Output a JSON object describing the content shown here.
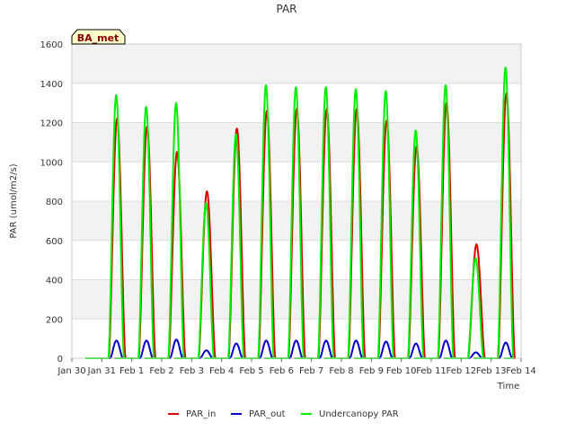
{
  "chart_data": {
    "type": "line",
    "title": "PAR",
    "xlabel": "Time",
    "ylabel": "PAR (umol/m2/s)",
    "badge": "BA_met",
    "ylim": [
      0,
      1600
    ],
    "yticks": [
      0,
      200,
      400,
      600,
      800,
      1000,
      1200,
      1400,
      1600
    ],
    "xlim": [
      0,
      15
    ],
    "xtick_labels": [
      "Jan 30",
      "Jan 31",
      "Feb 1",
      "Feb 2",
      "Feb 3",
      "Feb 4",
      "Feb 5",
      "Feb 6",
      "Feb 7",
      "Feb 8",
      "Feb 9",
      "Feb 10",
      "Feb 11",
      "Feb 12",
      "Feb 13",
      "Feb 14"
    ],
    "grid": true,
    "legend_position": "bottom-center",
    "daily_peaks": {
      "days": [
        "Jan 31",
        "Feb 1",
        "Feb 2",
        "Feb 3",
        "Feb 4",
        "Feb 5",
        "Feb 6",
        "Feb 7",
        "Feb 8",
        "Feb 9",
        "Feb 10",
        "Feb 11",
        "Feb 12",
        "Feb 13"
      ],
      "PAR_in": [
        1220,
        1180,
        1050,
        850,
        1170,
        1260,
        1270,
        1270,
        1270,
        1210,
        1080,
        1300,
        580,
        1350
      ],
      "PAR_out": [
        90,
        90,
        95,
        40,
        75,
        90,
        90,
        90,
        90,
        85,
        75,
        90,
        30,
        80
      ],
      "Undercanopy PAR": [
        1340,
        1280,
        1300,
        790,
        1140,
        1390,
        1380,
        1380,
        1370,
        1360,
        1160,
        1390,
        510,
        1480
      ]
    },
    "series": [
      {
        "name": "PAR_in",
        "color": "#dd0000"
      },
      {
        "name": "PAR_out",
        "color": "#0000cc"
      },
      {
        "name": "Undercanopy PAR",
        "color": "#00ee00"
      }
    ]
  }
}
